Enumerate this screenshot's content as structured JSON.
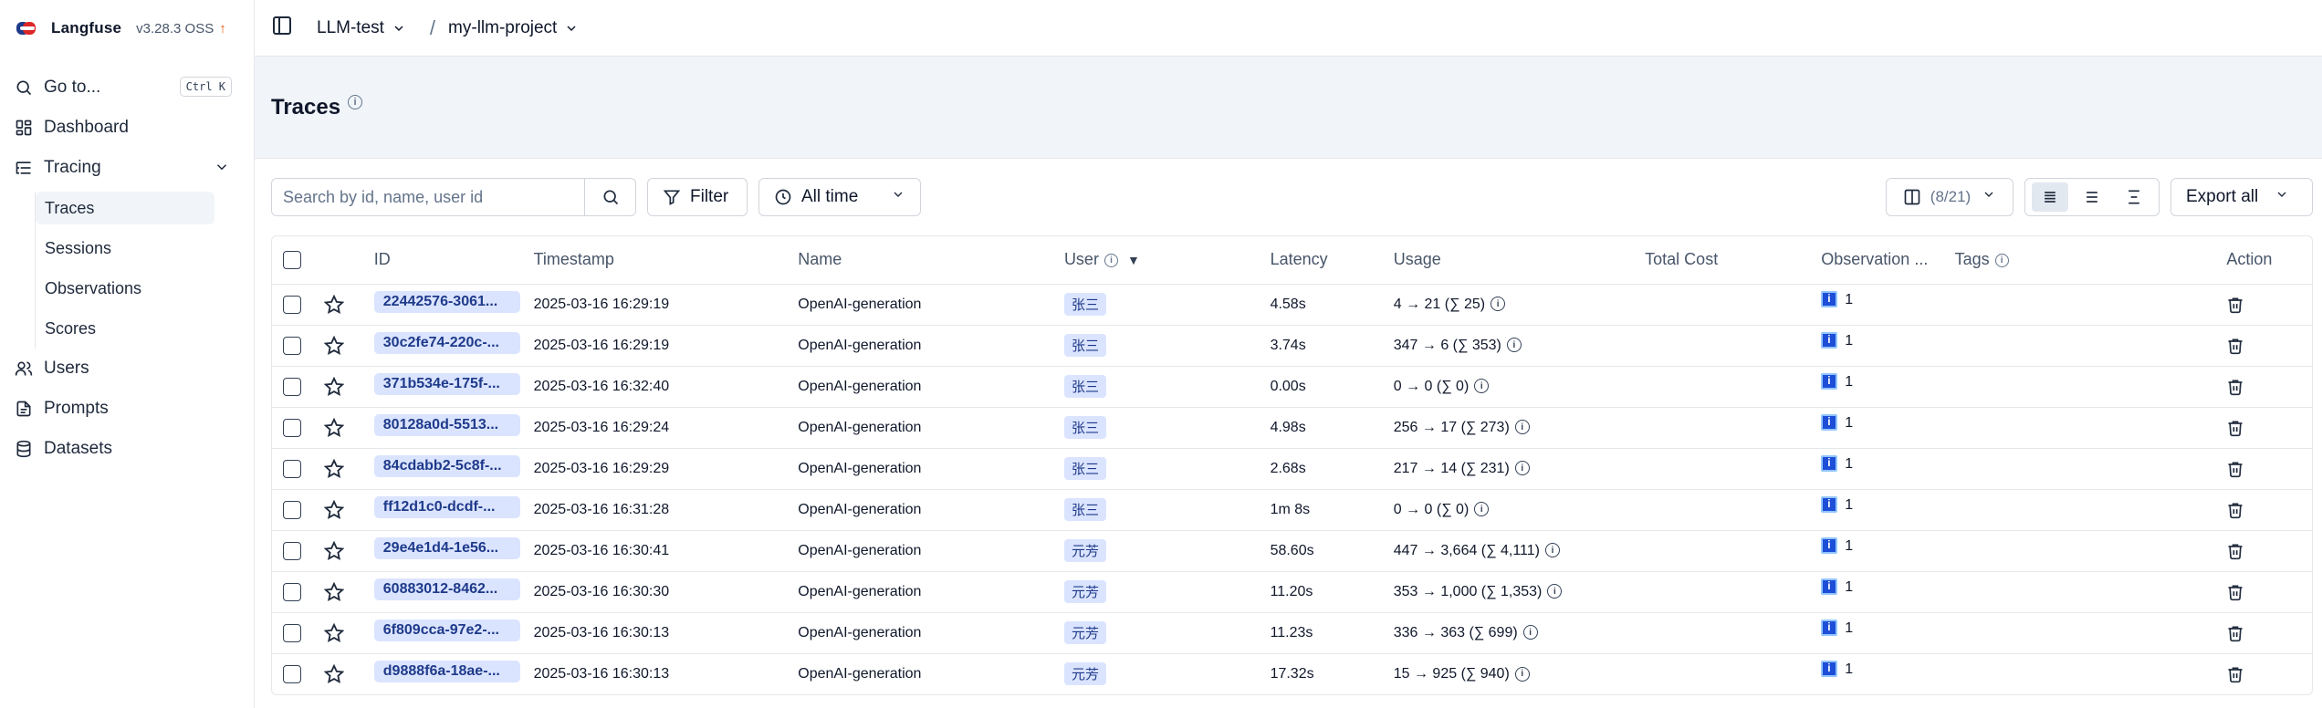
{
  "brand": {
    "name": "Langfuse",
    "version": "v3.28.3 OSS",
    "update_icon": "arrow-up-icon"
  },
  "sidebar": {
    "goto": {
      "label": "Go to...",
      "shortcut": "Ctrl K"
    },
    "items": [
      {
        "label": "Dashboard",
        "icon": "grid-icon"
      },
      {
        "label": "Tracing",
        "icon": "list-tree-icon"
      },
      {
        "label": "Users",
        "icon": "users-icon"
      },
      {
        "label": "Prompts",
        "icon": "file-text-icon"
      },
      {
        "label": "Datasets",
        "icon": "database-icon"
      }
    ],
    "tracing_sub": [
      "Traces",
      "Sessions",
      "Observations",
      "Scores"
    ]
  },
  "breadcrumb": {
    "org": "LLM-test",
    "project": "my-llm-project",
    "separator": "/"
  },
  "page": {
    "title": "Traces",
    "info_icon": "info-icon"
  },
  "toolbar": {
    "search_placeholder": "Search by id, name, user id",
    "filter_label": "Filter",
    "time_label": "All time",
    "columns_count": "(8/21)",
    "export_label": "Export all",
    "active_view": "list-icon"
  },
  "table": {
    "headers": [
      "ID",
      "Timestamp",
      "Name",
      "User",
      "Latency",
      "Usage",
      "Total Cost",
      "Observation ...",
      "Tags",
      "Action"
    ],
    "rows": [
      {
        "id": "22442576-3061...",
        "timestamp": "2025-03-16 16:29:19",
        "name": "OpenAI-generation",
        "user": "张三",
        "latency": "4.58s",
        "usage": "4 → 21 (∑ 25)",
        "cost": "",
        "observations": "1"
      },
      {
        "id": "30c2fe74-220c-...",
        "timestamp": "2025-03-16 16:29:19",
        "name": "OpenAI-generation",
        "user": "张三",
        "latency": "3.74s",
        "usage": "347 → 6 (∑ 353)",
        "cost": "",
        "observations": "1"
      },
      {
        "id": "371b534e-175f-...",
        "timestamp": "2025-03-16 16:32:40",
        "name": "OpenAI-generation",
        "user": "张三",
        "latency": "0.00s",
        "usage": "0 → 0 (∑ 0)",
        "cost": "",
        "observations": "1"
      },
      {
        "id": "80128a0d-5513...",
        "timestamp": "2025-03-16 16:29:24",
        "name": "OpenAI-generation",
        "user": "张三",
        "latency": "4.98s",
        "usage": "256 → 17 (∑ 273)",
        "cost": "",
        "observations": "1"
      },
      {
        "id": "84cdabb2-5c8f-...",
        "timestamp": "2025-03-16 16:29:29",
        "name": "OpenAI-generation",
        "user": "张三",
        "latency": "2.68s",
        "usage": "217 → 14 (∑ 231)",
        "cost": "",
        "observations": "1"
      },
      {
        "id": "ff12d1c0-dcdf-...",
        "timestamp": "2025-03-16 16:31:28",
        "name": "OpenAI-generation",
        "user": "张三",
        "latency": "1m 8s",
        "usage": "0 → 0 (∑ 0)",
        "cost": "",
        "observations": "1"
      },
      {
        "id": "29e4e1d4-1e56...",
        "timestamp": "2025-03-16 16:30:41",
        "name": "OpenAI-generation",
        "user": "元芳",
        "latency": "58.60s",
        "usage": "447 → 3,664 (∑ 4,111)",
        "cost": "",
        "observations": "1"
      },
      {
        "id": "60883012-8462...",
        "timestamp": "2025-03-16 16:30:30",
        "name": "OpenAI-generation",
        "user": "元芳",
        "latency": "11.20s",
        "usage": "353 → 1,000 (∑ 1,353)",
        "cost": "",
        "observations": "1"
      },
      {
        "id": "6f809cca-97e2-...",
        "timestamp": "2025-03-16 16:30:13",
        "name": "OpenAI-generation",
        "user": "元芳",
        "latency": "11.23s",
        "usage": "336 → 363 (∑ 699)",
        "cost": "",
        "observations": "1"
      },
      {
        "id": "d9888f6a-18ae-...",
        "timestamp": "2025-03-16 16:30:13",
        "name": "OpenAI-generation",
        "user": "元芳",
        "latency": "17.32s",
        "usage": "15 → 925 (∑ 940)",
        "cost": "",
        "observations": "1"
      }
    ]
  },
  "colors": {
    "chip_bg": "#dbe4ff",
    "chip_text": "#1e3a8a",
    "header_bg": "#f1f5f9",
    "update_arrow": "#ea580c"
  }
}
